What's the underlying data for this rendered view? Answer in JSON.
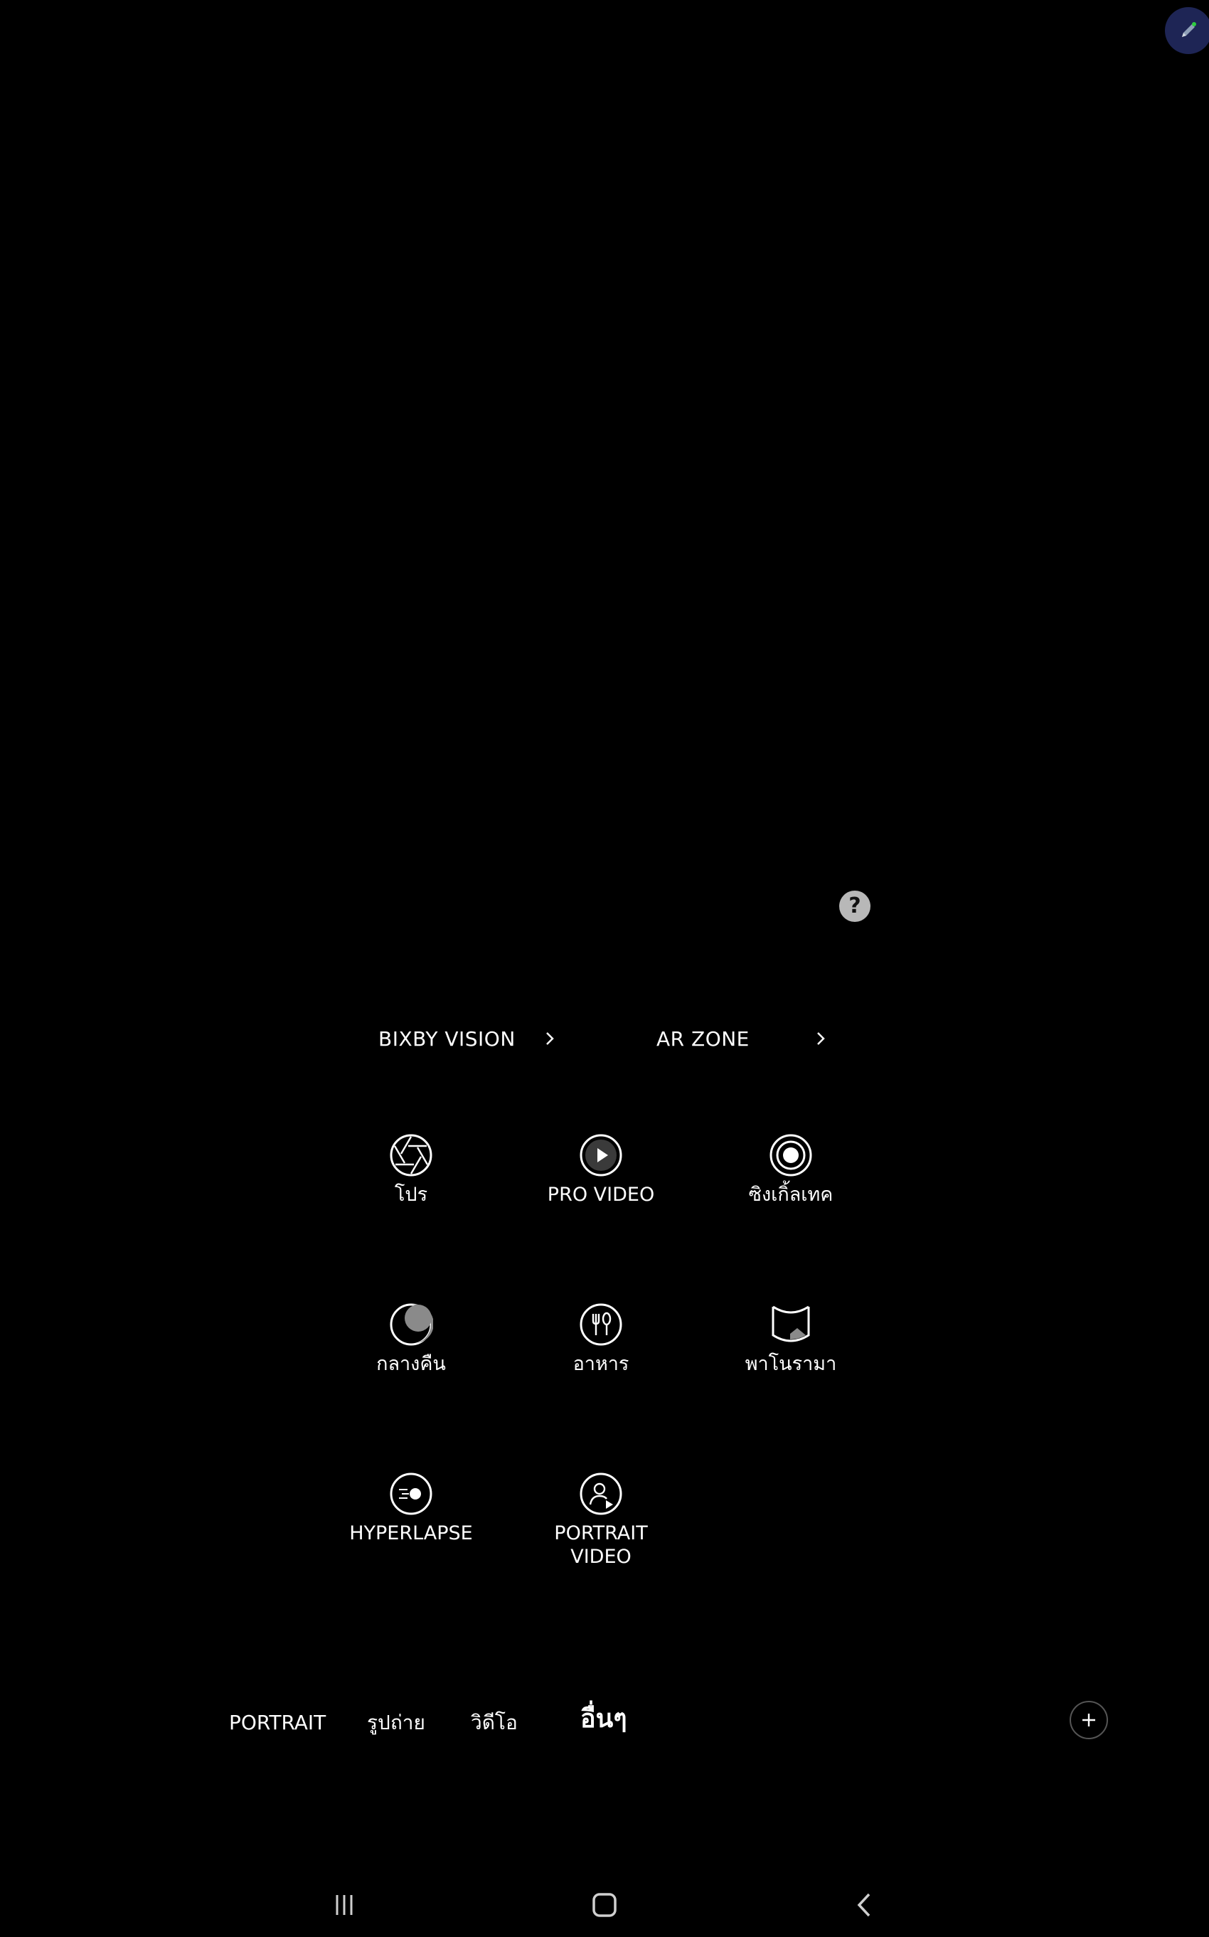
{
  "shortcuts": [
    {
      "label": "BIXBY VISION"
    },
    {
      "label": "AR ZONE"
    }
  ],
  "modes": [
    {
      "label": "โปร",
      "icon": "aperture-icon"
    },
    {
      "label": "PRO VIDEO",
      "icon": "pro-video-icon"
    },
    {
      "label": "ซิงเกิ้ลเทค",
      "icon": "single-take-icon"
    },
    {
      "label": "กลางคืน",
      "icon": "night-moon-icon"
    },
    {
      "label": "อาหาร",
      "icon": "food-icon"
    },
    {
      "label": "พาโนรามา",
      "icon": "panorama-icon"
    },
    {
      "label": "HYPERLAPSE",
      "icon": "hyperlapse-icon"
    },
    {
      "label": "PORTRAIT\nVIDEO",
      "icon": "portrait-video-icon"
    }
  ],
  "mode_bar": {
    "tabs": [
      {
        "label": "PORTRAIT"
      },
      {
        "label": "รูปถ่าย"
      },
      {
        "label": "วิดีโอ"
      },
      {
        "label": "อื่นๆ"
      }
    ],
    "active_index": 3
  },
  "colors": {
    "background": "#000000",
    "text": "#ffffff",
    "help_bg": "#b8b8b8",
    "edit_bubble": "#1e2555",
    "edit_accent": "#2ecc40"
  },
  "nav": {
    "recent_icon": "recent-apps-icon",
    "home_icon": "home-icon",
    "back_icon": "back-icon"
  }
}
